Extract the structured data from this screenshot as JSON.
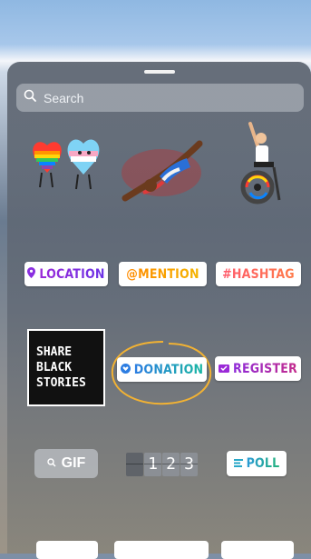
{
  "search": {
    "placeholder": "Search"
  },
  "stickers": {
    "location": "LOCATION",
    "mention": "@MENTION",
    "hashtag": "#HASHTAG",
    "share_lines": [
      "SHARE",
      "BLACK",
      "STORIES"
    ],
    "donation": "DONATION",
    "register": "REGISTER",
    "gif": "GIF",
    "counter_digits": [
      "1",
      "2",
      "3"
    ],
    "poll": "POLL"
  },
  "colors": {
    "location": "#8a2ee0",
    "mention": "#ff8f00",
    "hashtag": "#ff5a6a",
    "donation": "#2c7de2",
    "register": "#9b2ad8",
    "poll": "#2aa8c8",
    "highlight_circle": "#f2b233"
  }
}
